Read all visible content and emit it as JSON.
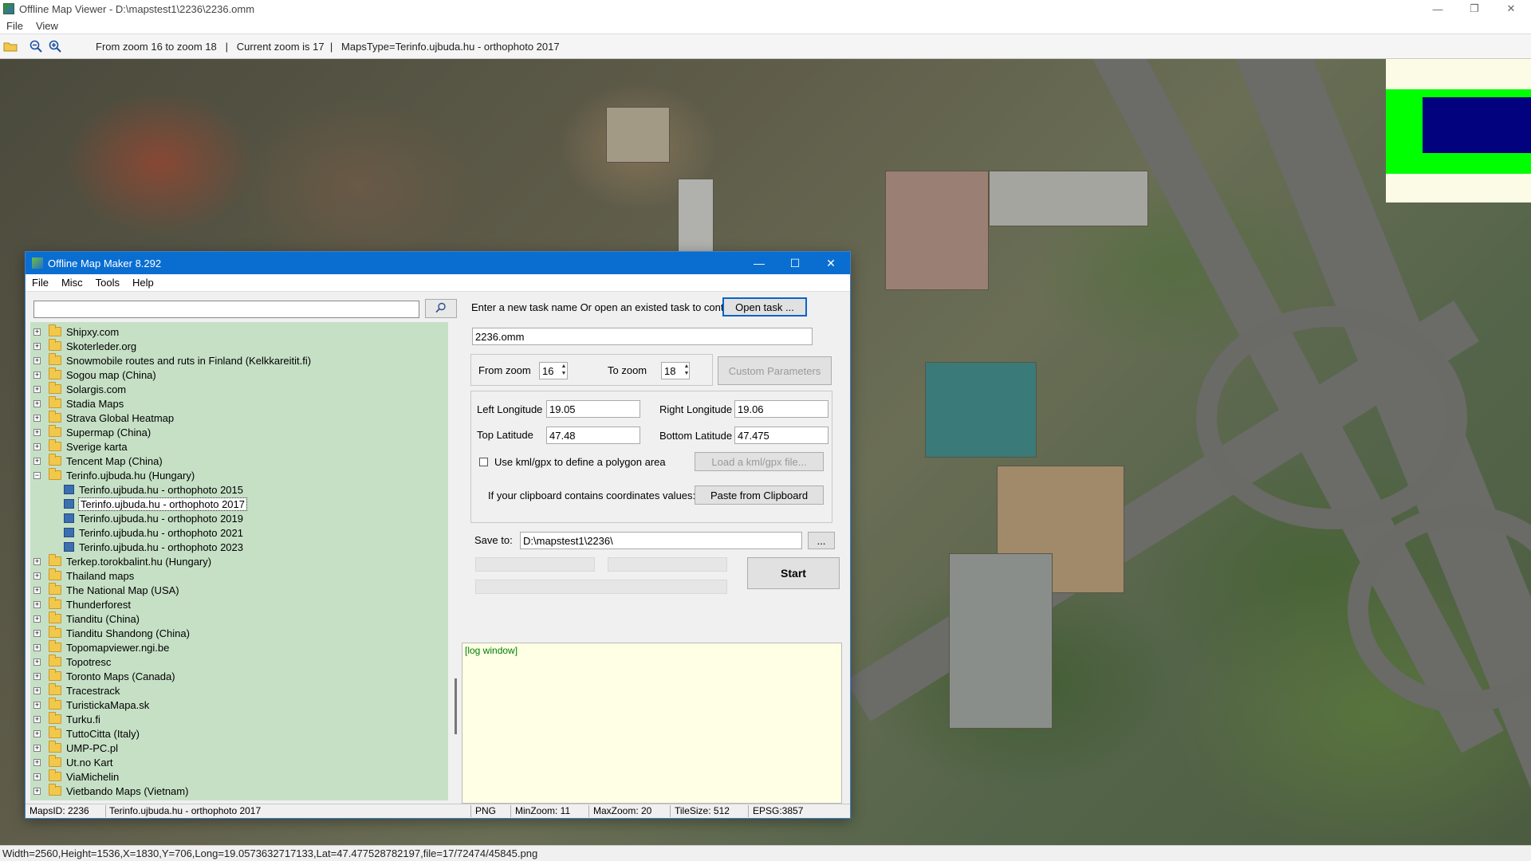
{
  "viewer": {
    "title": "Offline Map Viewer - D:\\mapstest1\\2236\\2236.omm",
    "menu": [
      "File",
      "View"
    ],
    "toolbar_info": "From zoom 16 to zoom 18   |   Current zoom is 17  |   MapsType=Terinfo.ujbuda.hu - orthophoto 2017",
    "status": "Width=2560,Height=1536,X=1830,Y=706,Long=19.0573632717133,Lat=47.477528782197,file=17/72474/45845.png"
  },
  "dialog": {
    "title": "Offline Map Maker 8.292",
    "menu": [
      "File",
      "Misc",
      "Tools",
      "Help"
    ],
    "search": {
      "value": ""
    },
    "tree": [
      {
        "label": "Shipxy.com",
        "type": "folder"
      },
      {
        "label": "Skoterleder.org",
        "type": "folder"
      },
      {
        "label": "Snowmobile routes and ruts in Finland (Kelkkareitit.fi)",
        "type": "folder"
      },
      {
        "label": "Sogou map (China)",
        "type": "folder"
      },
      {
        "label": "Solargis.com",
        "type": "folder"
      },
      {
        "label": "Stadia Maps",
        "type": "folder"
      },
      {
        "label": "Strava Global Heatmap",
        "type": "folder"
      },
      {
        "label": "Supermap (China)",
        "type": "folder"
      },
      {
        "label": "Sverige karta",
        "type": "folder"
      },
      {
        "label": "Tencent Map (China)",
        "type": "folder"
      },
      {
        "label": "Terinfo.ujbuda.hu (Hungary)",
        "type": "folder-open"
      },
      {
        "label": "Terinfo.ujbuda.hu - orthophoto 2015",
        "type": "child"
      },
      {
        "label": "Terinfo.ujbuda.hu - orthophoto 2017",
        "type": "child",
        "selected": true
      },
      {
        "label": "Terinfo.ujbuda.hu - orthophoto 2019",
        "type": "child"
      },
      {
        "label": "Terinfo.ujbuda.hu - orthophoto 2021",
        "type": "child"
      },
      {
        "label": "Terinfo.ujbuda.hu - orthophoto 2023",
        "type": "child"
      },
      {
        "label": "Terkep.torokbalint.hu (Hungary)",
        "type": "folder"
      },
      {
        "label": "Thailand maps",
        "type": "folder"
      },
      {
        "label": "The National Map (USA)",
        "type": "folder"
      },
      {
        "label": "Thunderforest",
        "type": "folder"
      },
      {
        "label": "Tianditu (China)",
        "type": "folder"
      },
      {
        "label": "Tianditu Shandong (China)",
        "type": "folder"
      },
      {
        "label": "Topomapviewer.ngi.be",
        "type": "folder"
      },
      {
        "label": "Topotresc",
        "type": "folder"
      },
      {
        "label": "Toronto Maps (Canada)",
        "type": "folder"
      },
      {
        "label": "Tracestrack",
        "type": "folder"
      },
      {
        "label": "TuristickaMapa.sk",
        "type": "folder"
      },
      {
        "label": "Turku.fi",
        "type": "folder"
      },
      {
        "label": "TuttoCitta (Italy)",
        "type": "folder"
      },
      {
        "label": "UMP-PC.pl",
        "type": "folder"
      },
      {
        "label": "Ut.no Kart",
        "type": "folder"
      },
      {
        "label": "ViaMichelin",
        "type": "folder"
      },
      {
        "label": "Vietbando Maps (Vietnam)",
        "type": "folder"
      }
    ],
    "task": {
      "prompt": "Enter a new task name Or open an existed task to continue:",
      "open_button": "Open task ...",
      "name_value": "2236.omm"
    },
    "zoom": {
      "from_label": "From zoom",
      "from_value": "16",
      "to_label": "To zoom",
      "to_value": "18",
      "custom_button": "Custom Parameters"
    },
    "coords": {
      "left_lon_label": "Left Longitude",
      "left_lon_value": "19.05",
      "right_lon_label": "Right Longitude",
      "right_lon_value": "19.06",
      "top_lat_label": "Top Latitude",
      "top_lat_value": "47.48",
      "bottom_lat_label": "Bottom Latitude",
      "bottom_lat_value": "47.475",
      "kml_checkbox_label": "Use kml/gpx to define a polygon area",
      "kml_button": "Load a kml/gpx file...",
      "clipboard_label": "If your clipboard contains coordinates values:",
      "clipboard_button": "Paste from Clipboard"
    },
    "save": {
      "label": "Save to:",
      "value": "D:\\mapstest1\\2236\\",
      "browse_button": "..."
    },
    "start_button": "Start",
    "log_text": "[log window]",
    "status": {
      "maps_id": "MapsID: 2236",
      "maps_name": "Terinfo.ujbuda.hu - orthophoto 2017",
      "format": "PNG",
      "min_zoom": "MinZoom: 11",
      "max_zoom": "MaxZoom: 20",
      "tile_size": "TileSize: 512",
      "epsg": "EPSG:3857"
    }
  }
}
